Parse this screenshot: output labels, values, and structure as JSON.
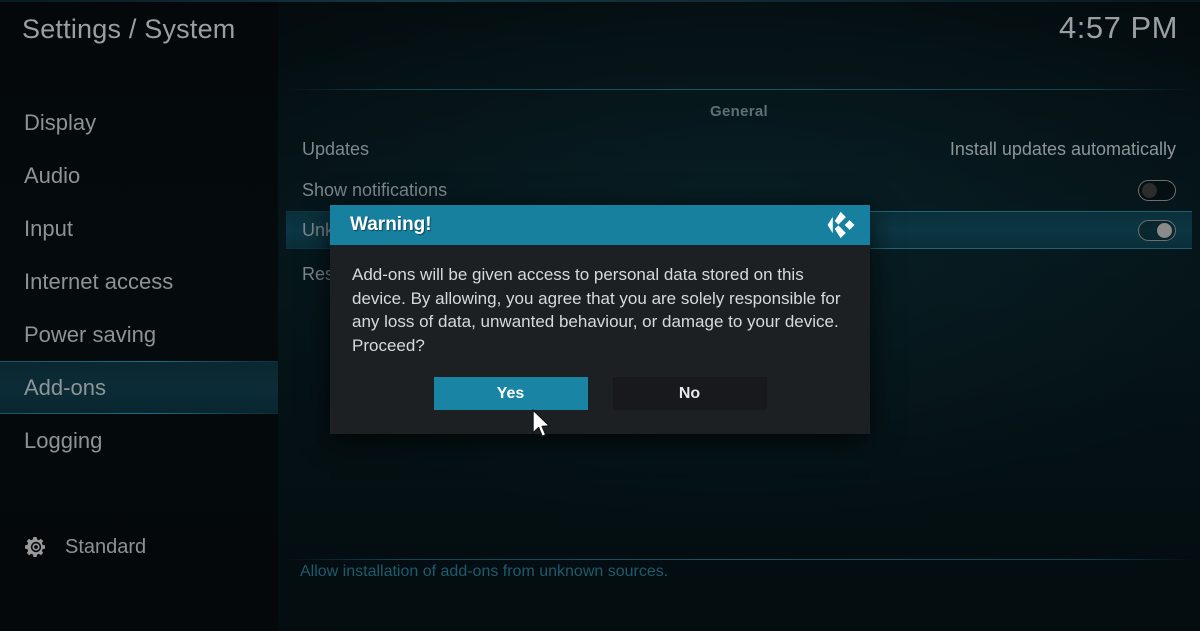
{
  "header": {
    "title": "Settings / System",
    "clock": "4:57 PM"
  },
  "sidebar": {
    "items": [
      {
        "label": "Display",
        "selected": false
      },
      {
        "label": "Audio",
        "selected": false
      },
      {
        "label": "Input",
        "selected": false
      },
      {
        "label": "Internet access",
        "selected": false
      },
      {
        "label": "Power saving",
        "selected": false
      },
      {
        "label": "Add-ons",
        "selected": true
      },
      {
        "label": "Logging",
        "selected": false
      }
    ],
    "profile": {
      "icon": "gear-icon",
      "label": "Standard"
    }
  },
  "main": {
    "section_title": "General",
    "rows": [
      {
        "label": "Updates",
        "value": "Install updates automatically",
        "control": "text"
      },
      {
        "label": "Show notifications",
        "value": "off",
        "control": "toggle"
      },
      {
        "label": "Unknown sources",
        "value": "on",
        "control": "toggle",
        "highlighted": true
      },
      {
        "label": "Reset above settings to default",
        "value": "",
        "control": "none"
      }
    ],
    "help_text": "Allow installation of add-ons from unknown sources."
  },
  "dialog": {
    "title": "Warning!",
    "logo_icon": "kodi-logo-icon",
    "message": "Add-ons will be given access to personal data stored on this device. By allowing, you agree that you are solely responsible for any loss of data, unwanted behaviour, or damage to your device. Proceed?",
    "buttons": {
      "confirm": "Yes",
      "cancel": "No"
    }
  },
  "colors": {
    "accent": "#17809f",
    "accent_button": "#1a84a5",
    "dialog_body": "#1d2023",
    "highlight_row": "#0c3643",
    "text_primary": "#d7dadc",
    "text_muted": "#8d9295",
    "help_text": "#1d5b6d"
  }
}
